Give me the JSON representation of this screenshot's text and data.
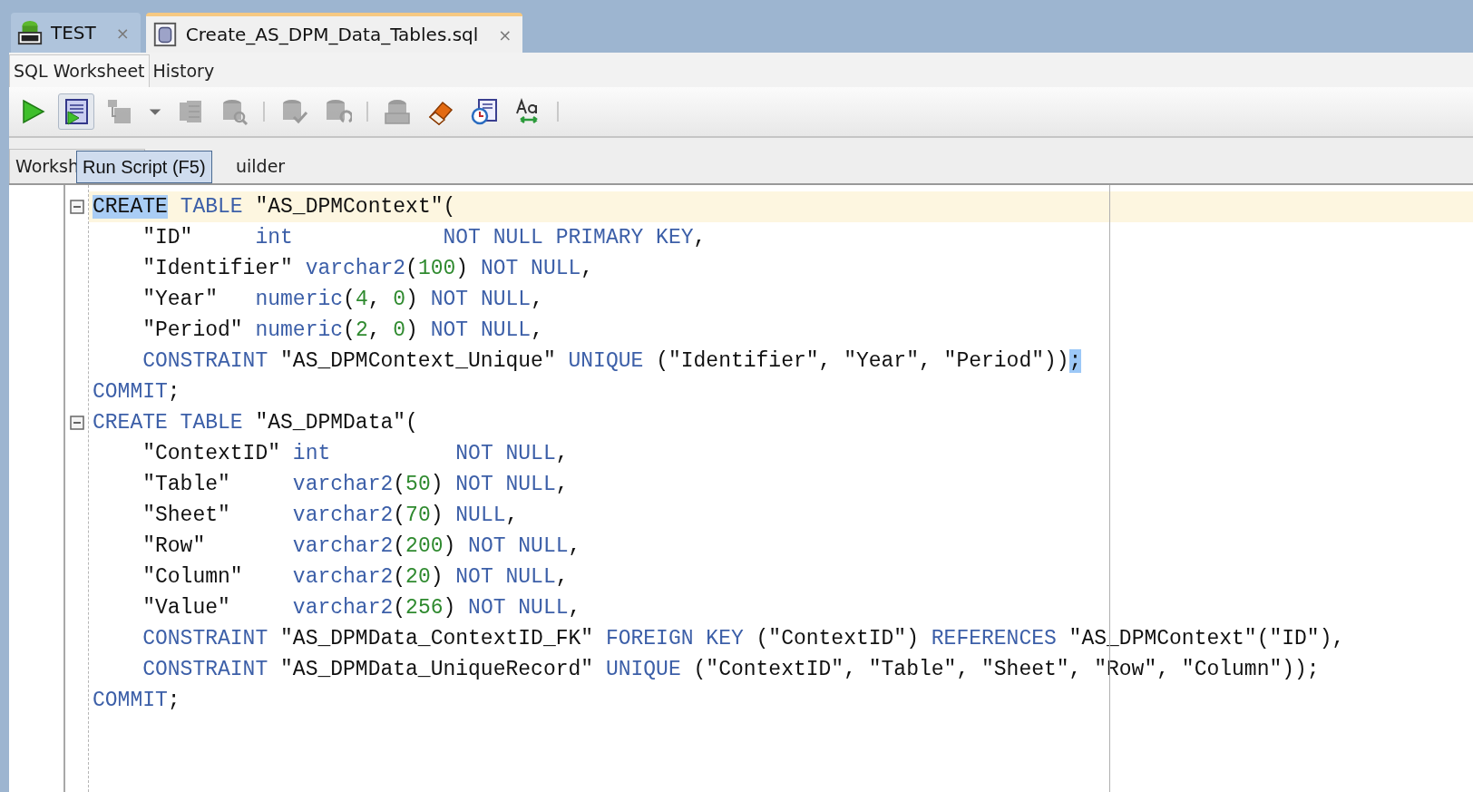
{
  "document_tabs": [
    {
      "label": "TEST",
      "kind": "connection",
      "close": "×",
      "selected": false
    },
    {
      "label": "Create_AS_DPM_Data_Tables.sql",
      "kind": "file",
      "close": "×",
      "selected": true
    }
  ],
  "view_tabs": [
    {
      "label": "SQL Worksheet",
      "selected": true
    },
    {
      "label": "History",
      "selected": false
    }
  ],
  "toolbar": [
    {
      "kind": "run",
      "disabled": false,
      "hovered": false
    },
    {
      "kind": "script",
      "disabled": false,
      "hovered": true
    },
    {
      "kind": "tree",
      "disabled": true,
      "hovered": false
    },
    {
      "kind": "caret",
      "disabled": false,
      "hovered": false
    },
    {
      "kind": "trace",
      "disabled": true,
      "hovered": false
    },
    {
      "kind": "db-search",
      "disabled": true,
      "hovered": false
    },
    {
      "kind": "separator"
    },
    {
      "kind": "db-check",
      "disabled": true,
      "hovered": false
    },
    {
      "kind": "db-undo",
      "disabled": true,
      "hovered": false
    },
    {
      "kind": "separator"
    },
    {
      "kind": "db-sql",
      "disabled": true,
      "hovered": false
    },
    {
      "kind": "eraser",
      "disabled": false,
      "hovered": false
    },
    {
      "kind": "clock-doc",
      "disabled": false,
      "hovered": false
    },
    {
      "kind": "format",
      "disabled": false,
      "hovered": false
    },
    {
      "kind": "separator"
    }
  ],
  "tooltip": "Run Script (F5)",
  "editor_tabs": [
    {
      "label": "Worksh",
      "selected": true
    },
    {
      "label": "uilder",
      "selected": false
    }
  ],
  "code_lines": [
    {
      "current": true,
      "foldable": true,
      "segments": [
        {
          "kind": "selection",
          "text": "CREATE"
        },
        {
          "kind": "keyword",
          "text": " TABLE "
        },
        {
          "kind": "plain",
          "text": "\"AS_DPMContext\"("
        }
      ]
    },
    {
      "current": false,
      "foldable": false,
      "indented": true,
      "segments": [
        {
          "kind": "plain",
          "text": "\"ID\"     "
        },
        {
          "kind": "keyword",
          "text": "int            NOT NULL PRIMARY KEY"
        },
        {
          "kind": "plain",
          "text": ","
        }
      ]
    },
    {
      "current": false,
      "foldable": false,
      "indented": true,
      "segments": [
        {
          "kind": "plain",
          "text": "\"Identifier\" "
        },
        {
          "kind": "keyword",
          "text": "varchar2"
        },
        {
          "kind": "plain",
          "text": "("
        },
        {
          "kind": "number",
          "text": "100"
        },
        {
          "kind": "plain",
          "text": ") "
        },
        {
          "kind": "keyword",
          "text": "NOT NULL"
        },
        {
          "kind": "plain",
          "text": ","
        }
      ]
    },
    {
      "current": false,
      "foldable": false,
      "indented": true,
      "segments": [
        {
          "kind": "plain",
          "text": "\"Year\"   "
        },
        {
          "kind": "keyword",
          "text": "numeric"
        },
        {
          "kind": "plain",
          "text": "("
        },
        {
          "kind": "number",
          "text": "4"
        },
        {
          "kind": "plain",
          "text": ", "
        },
        {
          "kind": "number",
          "text": "0"
        },
        {
          "kind": "plain",
          "text": ") "
        },
        {
          "kind": "keyword",
          "text": "NOT NULL"
        },
        {
          "kind": "plain",
          "text": ","
        }
      ]
    },
    {
      "current": false,
      "foldable": false,
      "indented": true,
      "segments": [
        {
          "kind": "plain",
          "text": "\"Period\" "
        },
        {
          "kind": "keyword",
          "text": "numeric"
        },
        {
          "kind": "plain",
          "text": "("
        },
        {
          "kind": "number",
          "text": "2"
        },
        {
          "kind": "plain",
          "text": ", "
        },
        {
          "kind": "number",
          "text": "0"
        },
        {
          "kind": "plain",
          "text": ") "
        },
        {
          "kind": "keyword",
          "text": "NOT NULL"
        },
        {
          "kind": "plain",
          "text": ","
        }
      ]
    },
    {
      "current": false,
      "foldable": false,
      "indented": true,
      "segments": [
        {
          "kind": "keyword",
          "text": "CONSTRAINT"
        },
        {
          "kind": "plain",
          "text": " \"AS_DPMContext_Unique\" "
        },
        {
          "kind": "keyword",
          "text": "UNIQUE"
        },
        {
          "kind": "plain",
          "text": " (\"Identifier\", \"Year\", \"Period\"))"
        },
        {
          "kind": "match",
          "text": ";"
        }
      ]
    },
    {
      "current": false,
      "foldable": false,
      "segments": [
        {
          "kind": "keyword",
          "text": "COMMIT"
        },
        {
          "kind": "plain",
          "text": ";"
        }
      ]
    },
    {
      "current": false,
      "foldable": true,
      "segments": [
        {
          "kind": "keyword",
          "text": "CREATE TABLE "
        },
        {
          "kind": "plain",
          "text": "\"AS_DPMData\"("
        }
      ]
    },
    {
      "current": false,
      "foldable": false,
      "indented": true,
      "segments": [
        {
          "kind": "plain",
          "text": "\"ContextID\" "
        },
        {
          "kind": "keyword",
          "text": "int          NOT NULL"
        },
        {
          "kind": "plain",
          "text": ","
        }
      ]
    },
    {
      "current": false,
      "foldable": false,
      "indented": true,
      "segments": [
        {
          "kind": "plain",
          "text": "\"Table\"     "
        },
        {
          "kind": "keyword",
          "text": "varchar2"
        },
        {
          "kind": "plain",
          "text": "("
        },
        {
          "kind": "number",
          "text": "50"
        },
        {
          "kind": "plain",
          "text": ") "
        },
        {
          "kind": "keyword",
          "text": "NOT NULL"
        },
        {
          "kind": "plain",
          "text": ","
        }
      ]
    },
    {
      "current": false,
      "foldable": false,
      "indented": true,
      "segments": [
        {
          "kind": "plain",
          "text": "\"Sheet\"     "
        },
        {
          "kind": "keyword",
          "text": "varchar2"
        },
        {
          "kind": "plain",
          "text": "("
        },
        {
          "kind": "number",
          "text": "70"
        },
        {
          "kind": "plain",
          "text": ") "
        },
        {
          "kind": "keyword",
          "text": "NULL"
        },
        {
          "kind": "plain",
          "text": ","
        }
      ]
    },
    {
      "current": false,
      "foldable": false,
      "indented": true,
      "segments": [
        {
          "kind": "plain",
          "text": "\"Row\"       "
        },
        {
          "kind": "keyword",
          "text": "varchar2"
        },
        {
          "kind": "plain",
          "text": "("
        },
        {
          "kind": "number",
          "text": "200"
        },
        {
          "kind": "plain",
          "text": ") "
        },
        {
          "kind": "keyword",
          "text": "NOT NULL"
        },
        {
          "kind": "plain",
          "text": ","
        }
      ]
    },
    {
      "current": false,
      "foldable": false,
      "indented": true,
      "segments": [
        {
          "kind": "plain",
          "text": "\"Column\"    "
        },
        {
          "kind": "keyword",
          "text": "varchar2"
        },
        {
          "kind": "plain",
          "text": "("
        },
        {
          "kind": "number",
          "text": "20"
        },
        {
          "kind": "plain",
          "text": ") "
        },
        {
          "kind": "keyword",
          "text": "NOT NULL"
        },
        {
          "kind": "plain",
          "text": ","
        }
      ]
    },
    {
      "current": false,
      "foldable": false,
      "indented": true,
      "segments": [
        {
          "kind": "plain",
          "text": "\"Value\"     "
        },
        {
          "kind": "keyword",
          "text": "varchar2"
        },
        {
          "kind": "plain",
          "text": "("
        },
        {
          "kind": "number",
          "text": "256"
        },
        {
          "kind": "plain",
          "text": ") "
        },
        {
          "kind": "keyword",
          "text": "NOT NULL"
        },
        {
          "kind": "plain",
          "text": ","
        }
      ]
    },
    {
      "current": false,
      "foldable": false,
      "indented": true,
      "segments": [
        {
          "kind": "keyword",
          "text": "CONSTRAINT"
        },
        {
          "kind": "plain",
          "text": " \"AS_DPMData_ContextID_FK\" "
        },
        {
          "kind": "keyword",
          "text": "FOREIGN KEY"
        },
        {
          "kind": "plain",
          "text": " (\"ContextID\") "
        },
        {
          "kind": "keyword",
          "text": "REFERENCES"
        },
        {
          "kind": "plain",
          "text": " \"AS_DPMContext\"(\"ID\"),"
        }
      ]
    },
    {
      "current": false,
      "foldable": false,
      "indented": true,
      "segments": [
        {
          "kind": "keyword",
          "text": "CONSTRAINT"
        },
        {
          "kind": "plain",
          "text": " \"AS_DPMData_UniqueRecord\" "
        },
        {
          "kind": "keyword",
          "text": "UNIQUE"
        },
        {
          "kind": "plain",
          "text": " (\"ContextID\", \"Table\", \"Sheet\", \"Row\", \"Column\"));"
        }
      ]
    },
    {
      "current": false,
      "foldable": false,
      "segments": [
        {
          "kind": "keyword",
          "text": "COMMIT"
        },
        {
          "kind": "plain",
          "text": ";"
        }
      ]
    }
  ]
}
